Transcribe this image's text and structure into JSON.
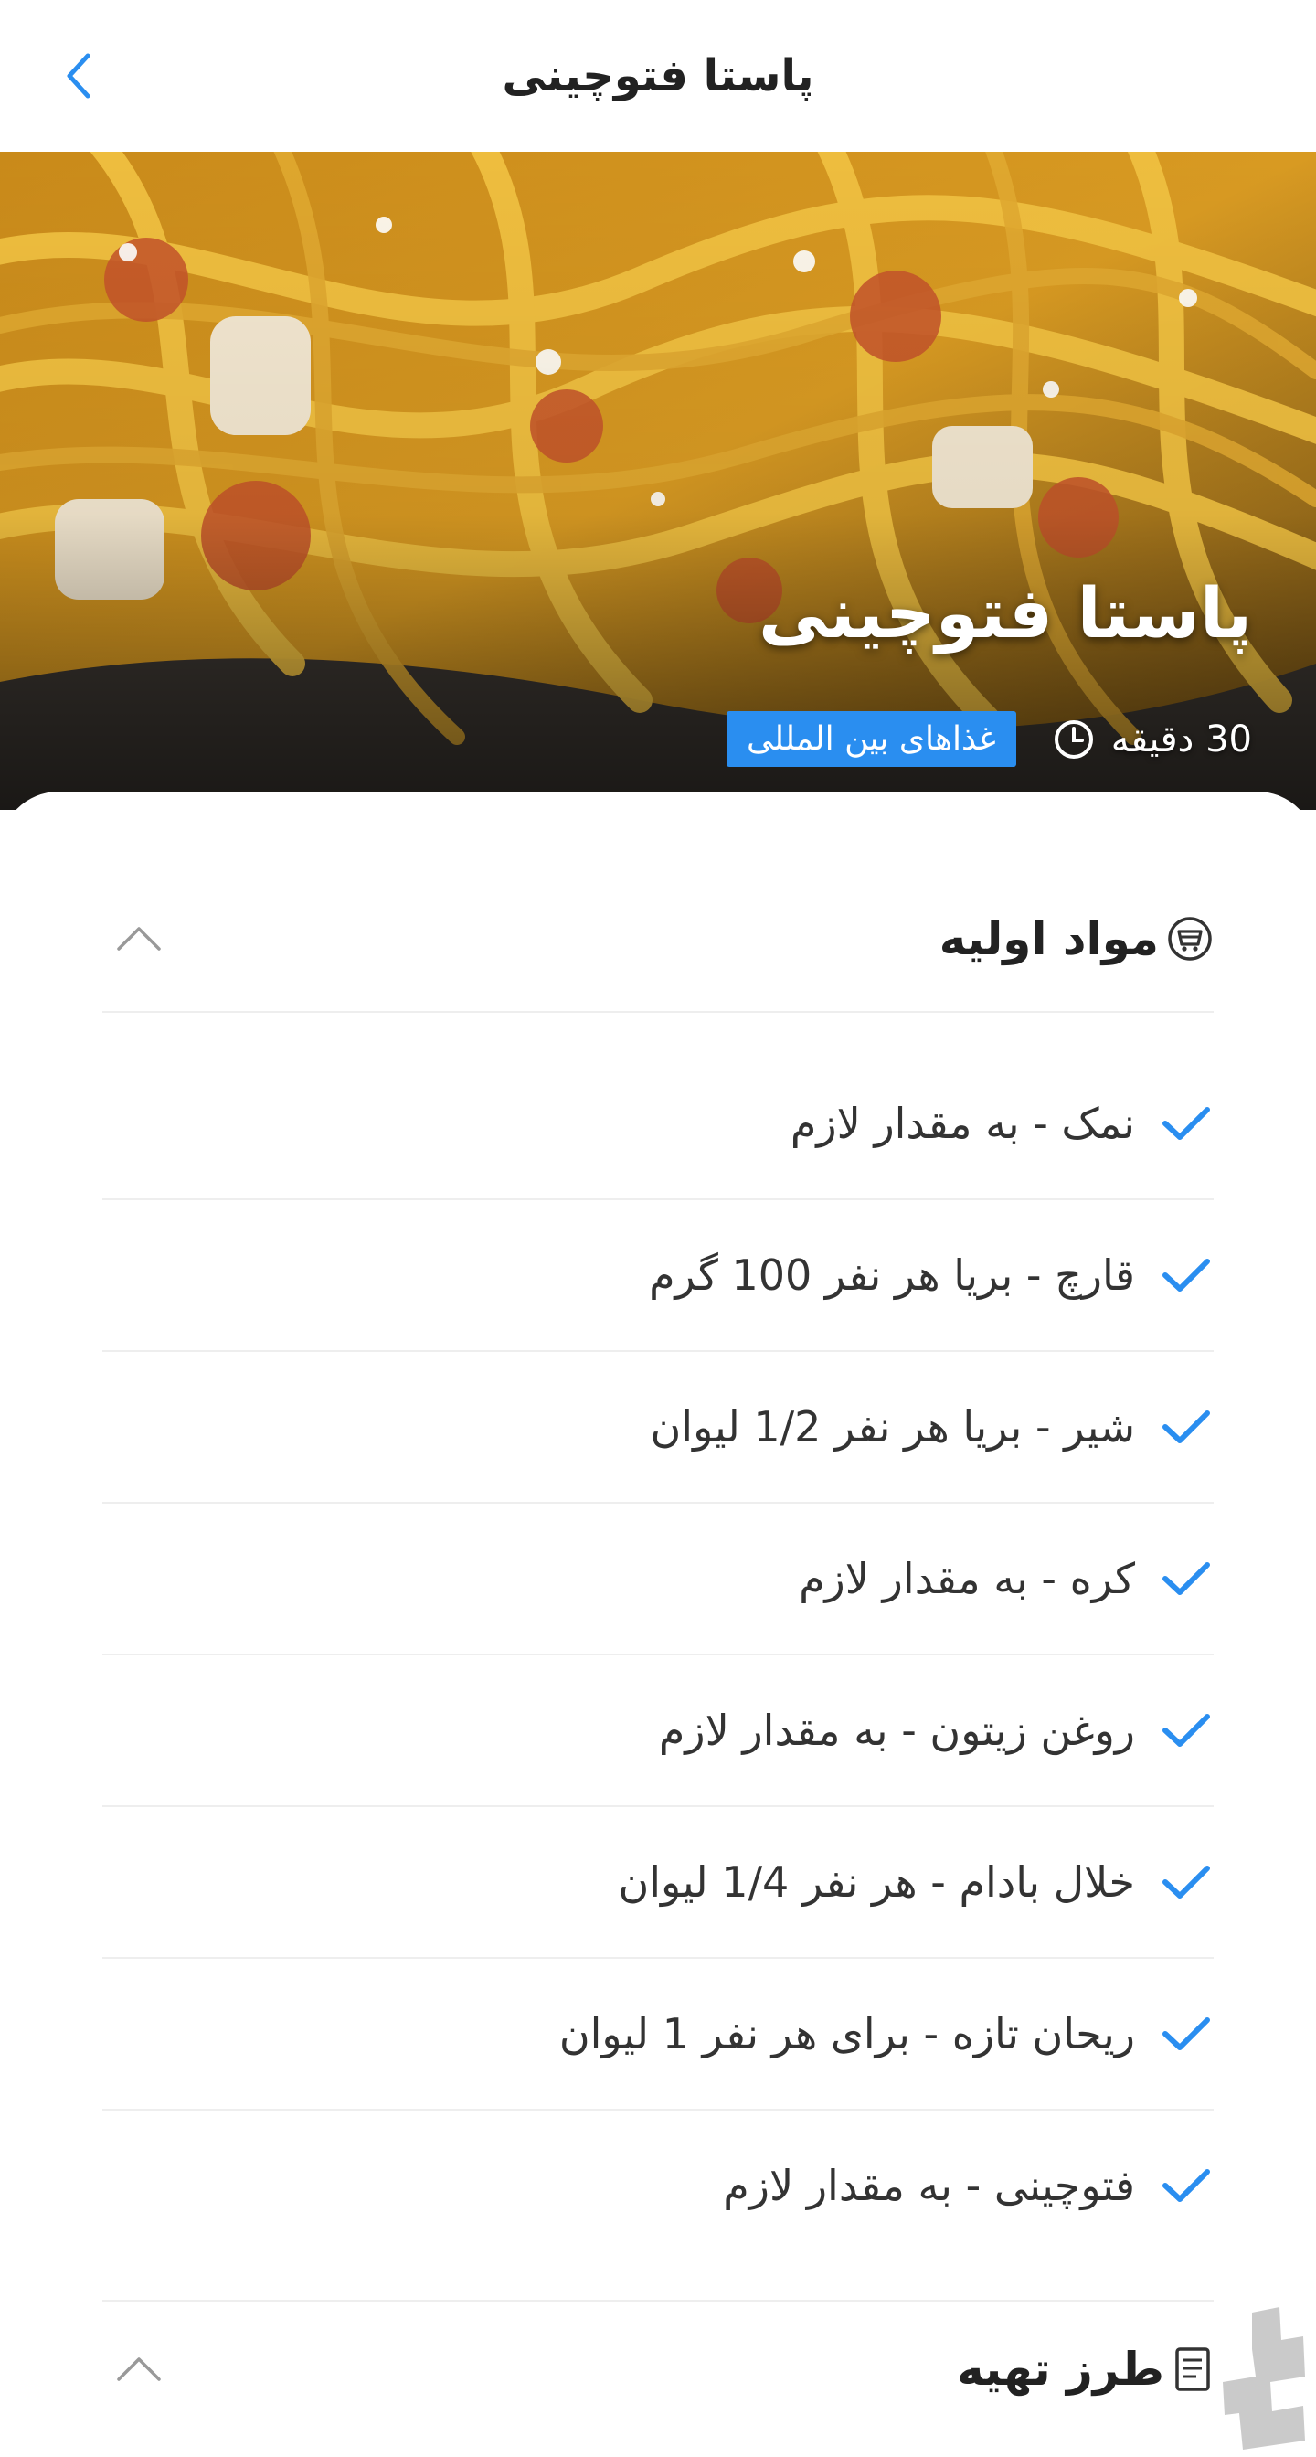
{
  "header": {
    "title": "پاستا فتوچینی",
    "back_icon": "chevron-left-icon",
    "accent_color": "#2a8ef0"
  },
  "hero": {
    "title": "پاستا فتوچینی",
    "category": "غذاهای بین المللی",
    "time": "30 دقیقه",
    "time_icon": "clock-icon"
  },
  "ingredients": {
    "title": "مواد اولیه",
    "icon": "basket-icon",
    "collapse_icon": "chevron-up-icon",
    "items": [
      "نمک - به مقدار لازم",
      "قارچ - بریا هر نفر 100 گرم",
      "شیر - بریا هر نفر 1/2 لیوان",
      "کره - به مقدار لازم",
      "روغن زیتون - به مقدار لازم",
      "خلال بادام - هر نفر 1/4 لیوان",
      "ریحان تازه - برای هر نفر 1 لیوان",
      "فتوچینی - به مقدار لازم"
    ],
    "check_icon": "check-icon"
  },
  "preparation": {
    "title": "طرز تهیه",
    "icon": "document-icon",
    "collapse_icon": "chevron-up-icon"
  },
  "watermark_icon": "store-logo-icon"
}
